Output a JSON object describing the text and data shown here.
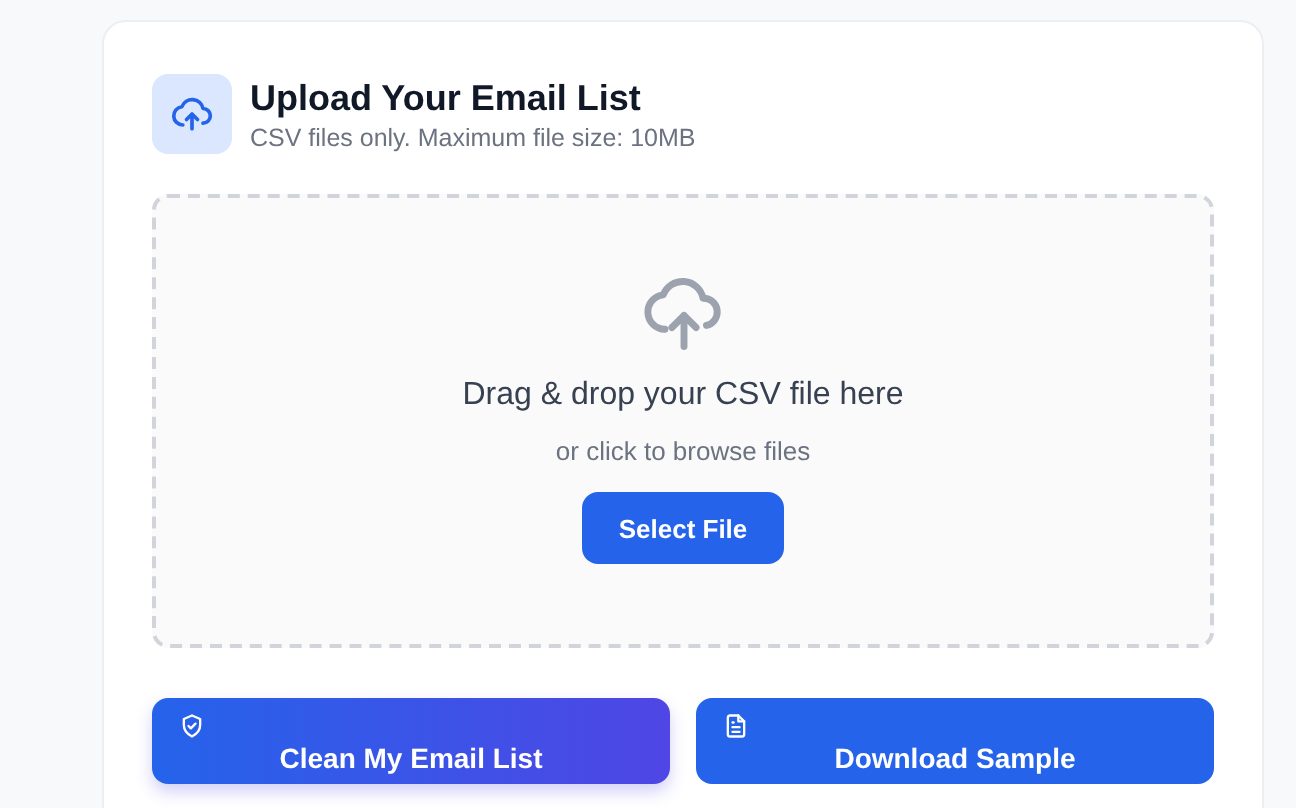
{
  "header": {
    "title": "Upload Your Email List",
    "subtitle": "CSV files only. Maximum file size: 10MB"
  },
  "dropzone": {
    "heading": "Drag & drop your CSV file here",
    "hint": "or click to browse files",
    "button": "Select File"
  },
  "actions": [
    {
      "label": "Clean My Email List",
      "kind": "clean"
    },
    {
      "label": "Download Sample",
      "kind": "download"
    }
  ]
}
